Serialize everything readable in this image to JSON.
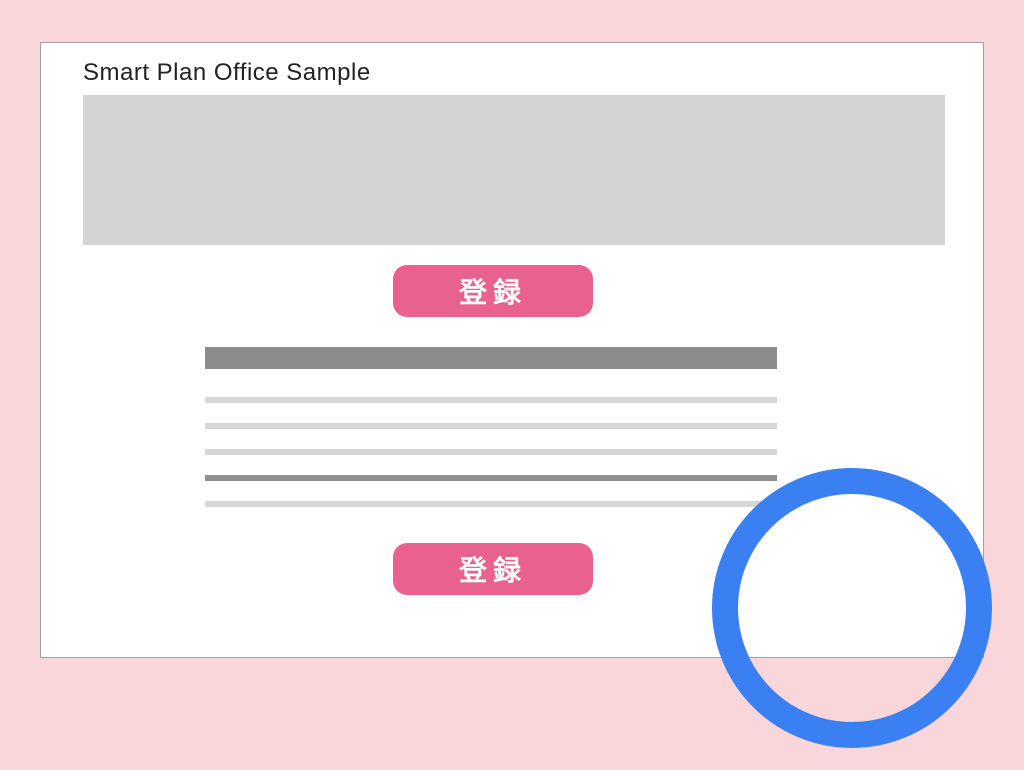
{
  "page": {
    "title": "Smart Plan Office Sample"
  },
  "buttons": {
    "register_top": "登録",
    "register_bottom": "登録"
  }
}
